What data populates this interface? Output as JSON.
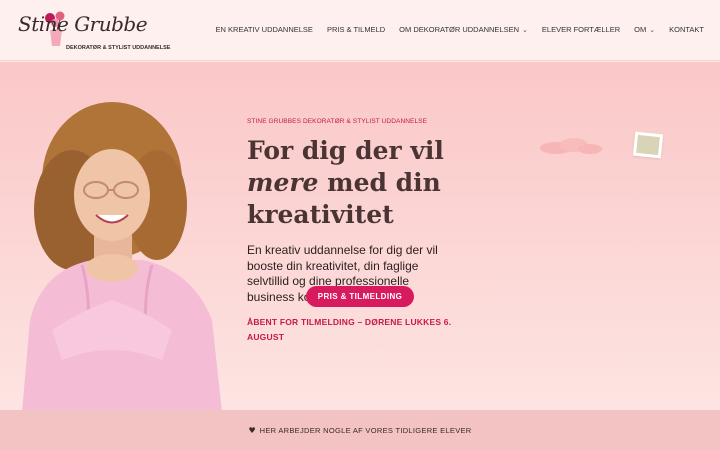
{
  "logo": {
    "script_name": "Stine Grubbe",
    "tagline": "DEKORATØR & STYLIST UDDANNELSE"
  },
  "nav": {
    "items": [
      {
        "label": "EN KREATIV UDDANNELSE",
        "has_dropdown": false
      },
      {
        "label": "PRIS & TILMELD",
        "has_dropdown": false
      },
      {
        "label": "OM DEKORATØR UDDANNELSEN",
        "has_dropdown": true
      },
      {
        "label": "ELEVER FORTÆLLER",
        "has_dropdown": false
      },
      {
        "label": "OM",
        "has_dropdown": true
      },
      {
        "label": "KONTAKT",
        "has_dropdown": false
      }
    ]
  },
  "hero": {
    "eyebrow": "STINE GRUBBES DEKORATØR & STYLIST UDDANNELSE",
    "headline_line1": "For dig der vil",
    "headline_em": "mere",
    "headline_line2_rest": " med din",
    "headline_line3": "kreativitet",
    "lead": "En kreativ  uddannelse for dig der vil booste din kreativitet, din faglige selvtillid og dine professionelle business kompetencer.",
    "open_notice": "ÅBENT FOR TILMELDING – DØRENE LUKKES 6. AUGUST",
    "cta_label": "PRIS & TILMELDING"
  },
  "band": {
    "heart_icon": "heart-icon",
    "text": "HER ARBEJDER NOGLE AF VORES TIDLIGERE ELEVER"
  },
  "colors": {
    "accent": "#d81b5f",
    "accent_text": "#c7184a",
    "hero_bg_top": "#fbc7c8",
    "band_bg": "#f2c3c2"
  }
}
